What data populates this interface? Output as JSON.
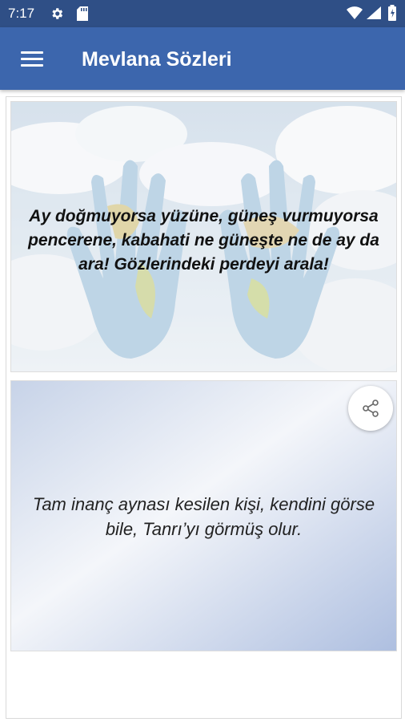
{
  "status_bar": {
    "time": "7:17",
    "icons": [
      "gear-icon",
      "sd-card-icon",
      "wifi-icon",
      "signal-icon",
      "battery-icon"
    ]
  },
  "app_bar": {
    "title": "Mevlana Sözleri",
    "menu_icon": "hamburger-menu-icon",
    "color": "#3c66ad"
  },
  "quotes": [
    {
      "text": "Ay doğmuyorsa yüzüne, güneş vurmuyorsa pencerene, kabahati ne güneşte ne de ay da ara! Gözlerindeki perdeyi arala!",
      "background": "hands-world-map-clouds"
    },
    {
      "text": "Tam inanç aynası kesilen kişi, kendini görse bile, Tanrı’yı görmüş olur.",
      "background": "soft-blue-gradient",
      "share_icon": "share-icon"
    }
  ],
  "colors": {
    "status_bar": "#2f4f86",
    "app_bar": "#3c66ad",
    "accent": "#3c66ad"
  }
}
